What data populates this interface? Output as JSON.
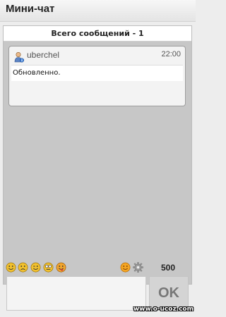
{
  "header": {
    "title": "Мини-чат"
  },
  "chat": {
    "total_label": "Всего сообщений - 1",
    "messages": [
      {
        "user": "uberchel",
        "time": "22:00",
        "text": "Обновленно."
      }
    ]
  },
  "toolbar": {
    "smileys": [
      "smile-icon",
      "sad-icon",
      "wink-icon",
      "cool-icon",
      "tongue-icon"
    ],
    "char_counter": "500"
  },
  "form": {
    "message_value": "",
    "ok_label": "OK"
  },
  "watermark": "www.o-ucoz.com",
  "colors": {
    "panel_bg": "#c7c7c7",
    "smiley_yellow": "#f2c12e",
    "ok_text": "#777777"
  }
}
